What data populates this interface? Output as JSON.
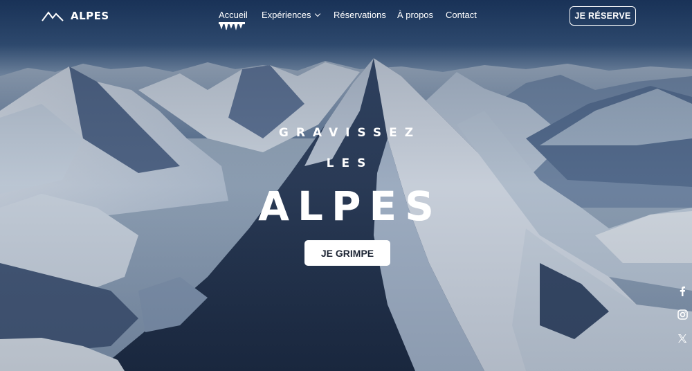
{
  "brand": {
    "name": "ALPES",
    "logo_icon": "mountain-logo-icon"
  },
  "nav": {
    "items": [
      {
        "label": "Accueil",
        "active": true
      },
      {
        "label": "Expériences",
        "has_dropdown": true
      },
      {
        "label": "Réservations"
      },
      {
        "label": "À propos"
      },
      {
        "label": "Contact"
      }
    ]
  },
  "header_cta": {
    "label": "JE RÉSERVE"
  },
  "hero": {
    "line1": "GRAVISSEZ",
    "line2": "LES",
    "line3": "ALPES",
    "cta_label": "JE GRIMPE"
  },
  "social": [
    {
      "icon": "facebook-icon"
    },
    {
      "icon": "instagram-icon"
    },
    {
      "icon": "x-twitter-icon"
    }
  ],
  "colors": {
    "sky_top": "#23436e",
    "sky_bottom": "#8ea6c0",
    "snow": "#e8eef5",
    "rock_shadow": "#27354c",
    "text": "#ffffff",
    "cta_text": "#1c2433"
  }
}
